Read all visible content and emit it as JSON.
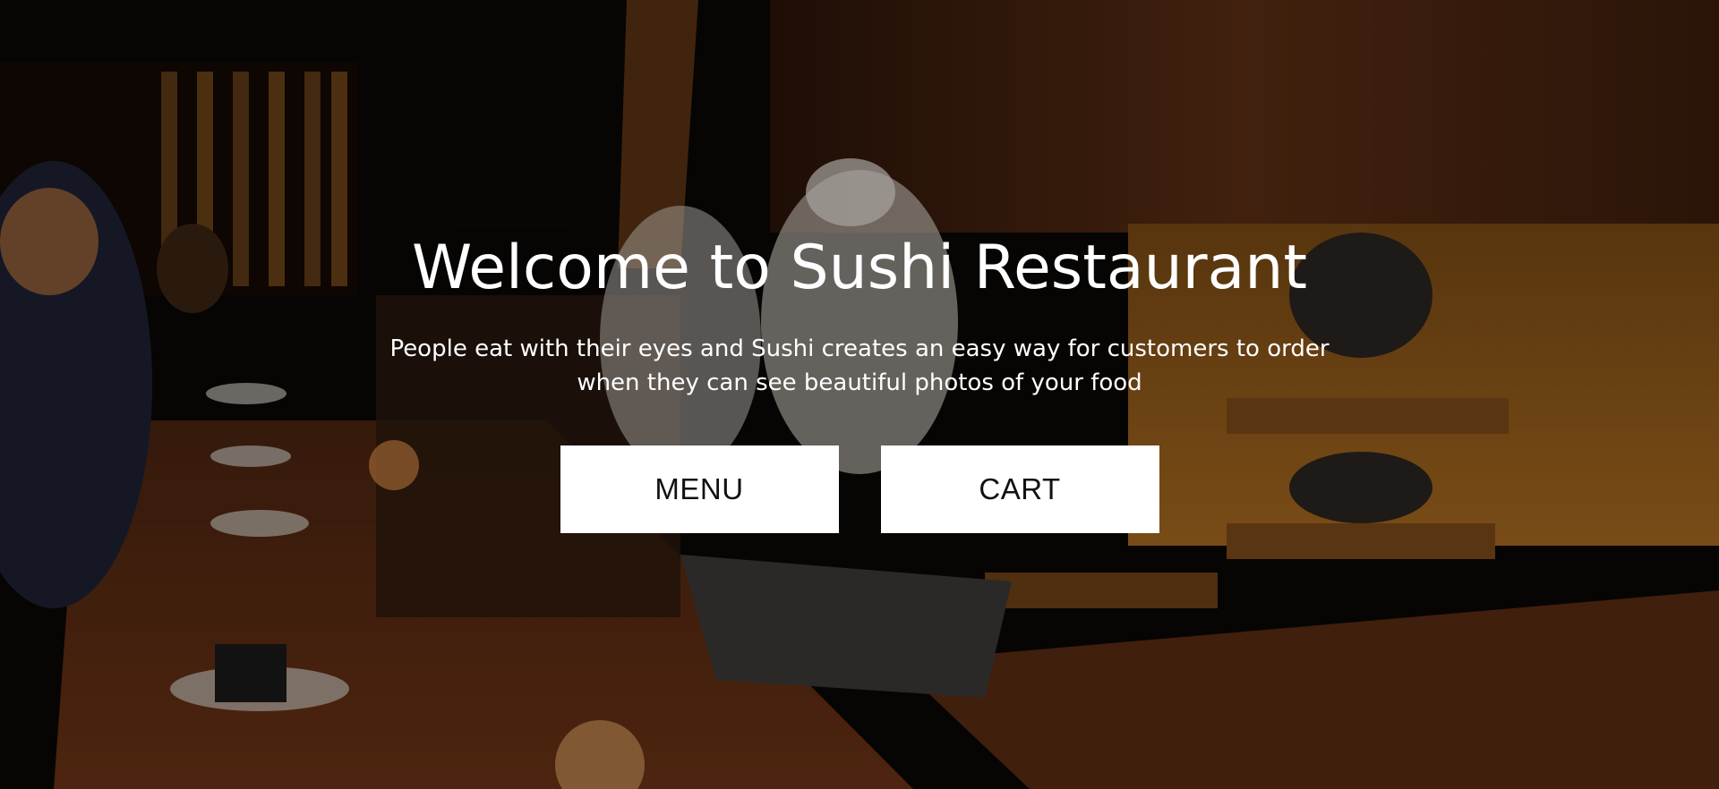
{
  "hero": {
    "title": "Welcome to Sushi Restaurant",
    "subtitle": "People eat with their eyes and Sushi creates an easy way for customers to order when they can see beautiful photos of your food",
    "background_image": "sushi-bar-kitchen-photo"
  },
  "buttons": {
    "menu_label": "MENU",
    "cart_label": "CART"
  },
  "colors": {
    "overlay": "#000000",
    "button_bg": "#ffffff",
    "button_text": "#111111",
    "text": "#ffffff"
  }
}
